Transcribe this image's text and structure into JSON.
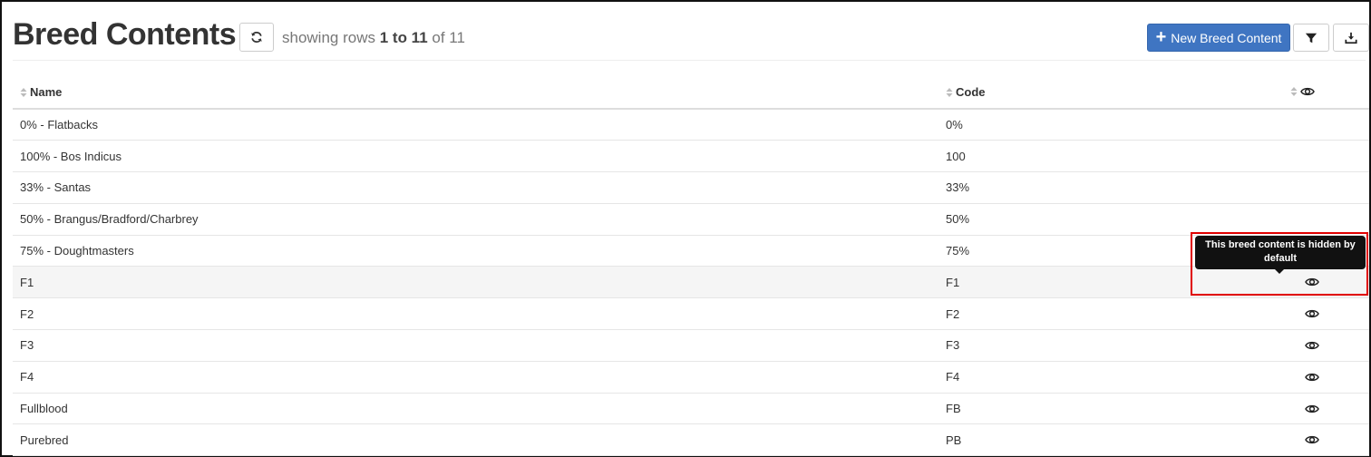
{
  "header": {
    "title": "Breed Contents",
    "rows_prefix": "showing rows",
    "rows_range": "1 to 11",
    "rows_suffix": "of 11",
    "new_button_label": "New Breed Content"
  },
  "table": {
    "columns": [
      "Name",
      "Code"
    ],
    "rows": [
      {
        "name": "0% - Flatbacks",
        "code": "0%",
        "hidden": false
      },
      {
        "name": "100% - Bos Indicus",
        "code": "100",
        "hidden": false
      },
      {
        "name": "33% - Santas",
        "code": "33%",
        "hidden": false
      },
      {
        "name": "50% - Brangus/Bradford/Charbrey",
        "code": "50%",
        "hidden": false
      },
      {
        "name": "75% - Doughtmasters",
        "code": "75%",
        "hidden": false
      },
      {
        "name": "F1",
        "code": "F1",
        "hidden": true
      },
      {
        "name": "F2",
        "code": "F2",
        "hidden": true
      },
      {
        "name": "F3",
        "code": "F3",
        "hidden": true
      },
      {
        "name": "F4",
        "code": "F4",
        "hidden": true
      },
      {
        "name": "Fullblood",
        "code": "FB",
        "hidden": true
      },
      {
        "name": "Purebred",
        "code": "PB",
        "hidden": true
      }
    ]
  },
  "tooltip": {
    "text": "This breed content is hidden by default"
  },
  "colors": {
    "primary": "#3f75c2",
    "highlight_border": "#e00000"
  }
}
